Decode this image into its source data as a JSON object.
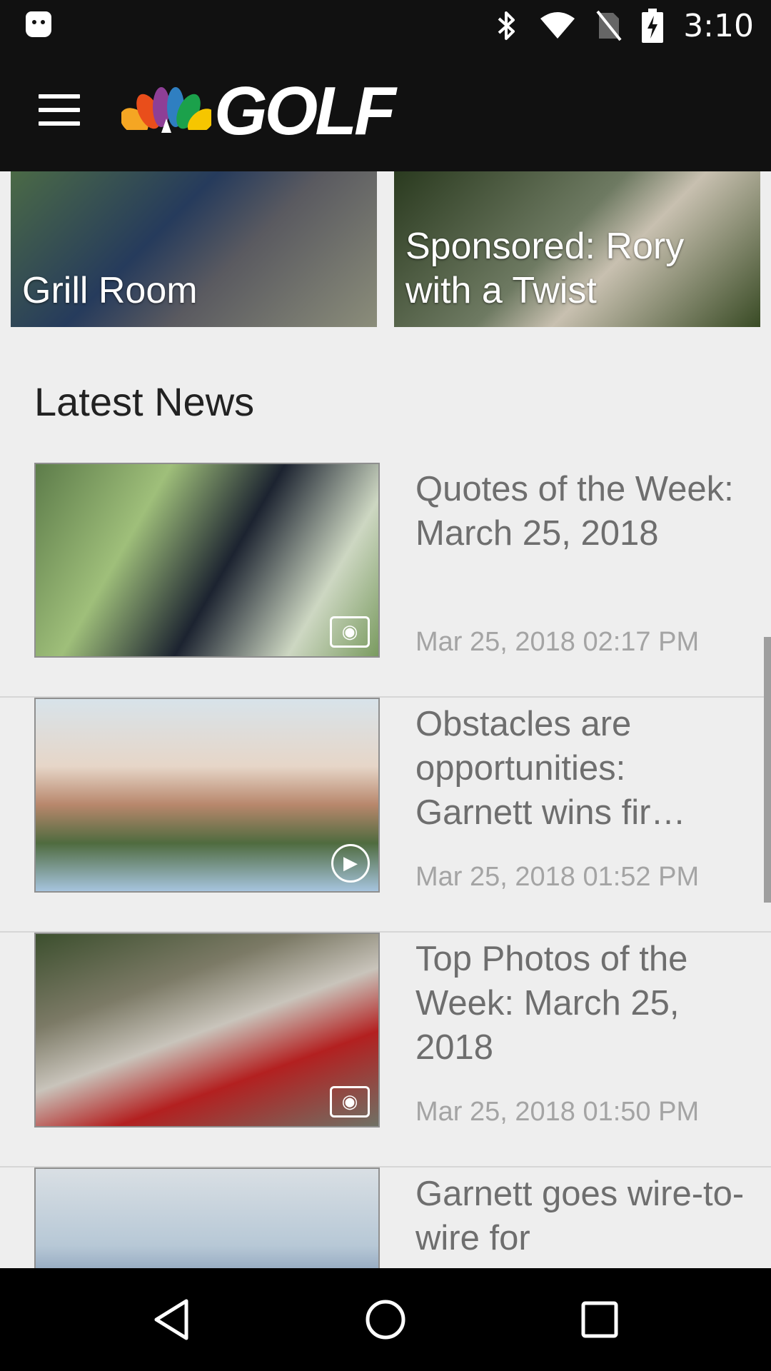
{
  "status_bar": {
    "time": "3:10",
    "icons": [
      "android-debug-icon",
      "bluetooth-icon",
      "wifi-icon",
      "no-sim-icon",
      "battery-charging-icon"
    ]
  },
  "app_bar": {
    "menu_icon": "hamburger-menu-icon",
    "brand_logo": "nbc-peacock-logo",
    "brand_text": "GOLF"
  },
  "featured_tiles": [
    {
      "caption": "Grill Room"
    },
    {
      "caption": "Sponsored: Rory with a Twist"
    }
  ],
  "latest_news": {
    "title": "Latest News",
    "items": [
      {
        "headline": "Quotes of the Week: March 25, 2018",
        "timestamp": "Mar 25, 2018 02:17 PM",
        "media_type": "camera-icon"
      },
      {
        "headline": "Obstacles are opportunities: Garnett wins fir…",
        "timestamp": "Mar 25, 2018 01:52 PM",
        "media_type": "play-icon"
      },
      {
        "headline": "Top Photos of the Week: March 25, 2018",
        "timestamp": "Mar 25, 2018 01:50 PM",
        "media_type": "camera-icon"
      },
      {
        "headline": "Garnett goes wire-to-wire for",
        "timestamp": "",
        "media_type": ""
      }
    ]
  },
  "navigation_bar": {
    "buttons": [
      "back-icon",
      "home-icon",
      "recent-apps-icon"
    ]
  },
  "colors": {
    "app_bar": "#111111",
    "background": "#eeeeee",
    "headline": "#6e6e6e",
    "timestamp": "#a4a4a4"
  }
}
